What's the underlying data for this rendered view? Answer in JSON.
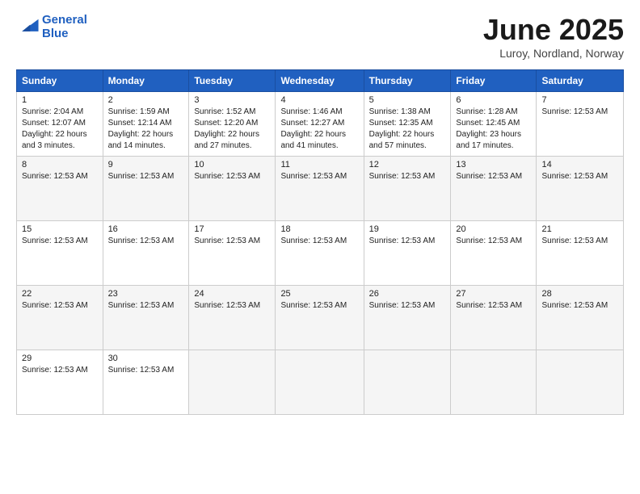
{
  "logo": {
    "line1": "General",
    "line2": "Blue"
  },
  "title": "June 2025",
  "location": "Luroy, Nordland, Norway",
  "weekdays": [
    "Sunday",
    "Monday",
    "Tuesday",
    "Wednesday",
    "Thursday",
    "Friday",
    "Saturday"
  ],
  "weeks": [
    [
      {
        "num": "1",
        "info": "Sunrise: 2:04 AM\nSunset: 12:07 AM\nDaylight: 22 hours\nand 3 minutes."
      },
      {
        "num": "2",
        "info": "Sunrise: 1:59 AM\nSunset: 12:14 AM\nDaylight: 22 hours\nand 14 minutes."
      },
      {
        "num": "3",
        "info": "Sunrise: 1:52 AM\nSunset: 12:20 AM\nDaylight: 22 hours\nand 27 minutes."
      },
      {
        "num": "4",
        "info": "Sunrise: 1:46 AM\nSunset: 12:27 AM\nDaylight: 22 hours\nand 41 minutes."
      },
      {
        "num": "5",
        "info": "Sunrise: 1:38 AM\nSunset: 12:35 AM\nDaylight: 22 hours\nand 57 minutes."
      },
      {
        "num": "6",
        "info": "Sunrise: 1:28 AM\nSunset: 12:45 AM\nDaylight: 23 hours\nand 17 minutes."
      },
      {
        "num": "7",
        "info": "Sunrise: 12:53 AM"
      }
    ],
    [
      {
        "num": "8",
        "info": "Sunrise: 12:53 AM"
      },
      {
        "num": "9",
        "info": "Sunrise: 12:53 AM"
      },
      {
        "num": "10",
        "info": "Sunrise: 12:53 AM"
      },
      {
        "num": "11",
        "info": "Sunrise: 12:53 AM"
      },
      {
        "num": "12",
        "info": "Sunrise: 12:53 AM"
      },
      {
        "num": "13",
        "info": "Sunrise: 12:53 AM"
      },
      {
        "num": "14",
        "info": "Sunrise: 12:53 AM"
      }
    ],
    [
      {
        "num": "15",
        "info": "Sunrise: 12:53 AM"
      },
      {
        "num": "16",
        "info": "Sunrise: 12:53 AM"
      },
      {
        "num": "17",
        "info": "Sunrise: 12:53 AM"
      },
      {
        "num": "18",
        "info": "Sunrise: 12:53 AM"
      },
      {
        "num": "19",
        "info": "Sunrise: 12:53 AM"
      },
      {
        "num": "20",
        "info": "Sunrise: 12:53 AM"
      },
      {
        "num": "21",
        "info": "Sunrise: 12:53 AM"
      }
    ],
    [
      {
        "num": "22",
        "info": "Sunrise: 12:53 AM"
      },
      {
        "num": "23",
        "info": "Sunrise: 12:53 AM"
      },
      {
        "num": "24",
        "info": "Sunrise: 12:53 AM"
      },
      {
        "num": "25",
        "info": "Sunrise: 12:53 AM"
      },
      {
        "num": "26",
        "info": "Sunrise: 12:53 AM"
      },
      {
        "num": "27",
        "info": "Sunrise: 12:53 AM"
      },
      {
        "num": "28",
        "info": "Sunrise: 12:53 AM"
      }
    ],
    [
      {
        "num": "29",
        "info": "Sunrise: 12:53 AM"
      },
      {
        "num": "30",
        "info": "Sunrise: 12:53 AM"
      },
      null,
      null,
      null,
      null,
      null
    ]
  ]
}
